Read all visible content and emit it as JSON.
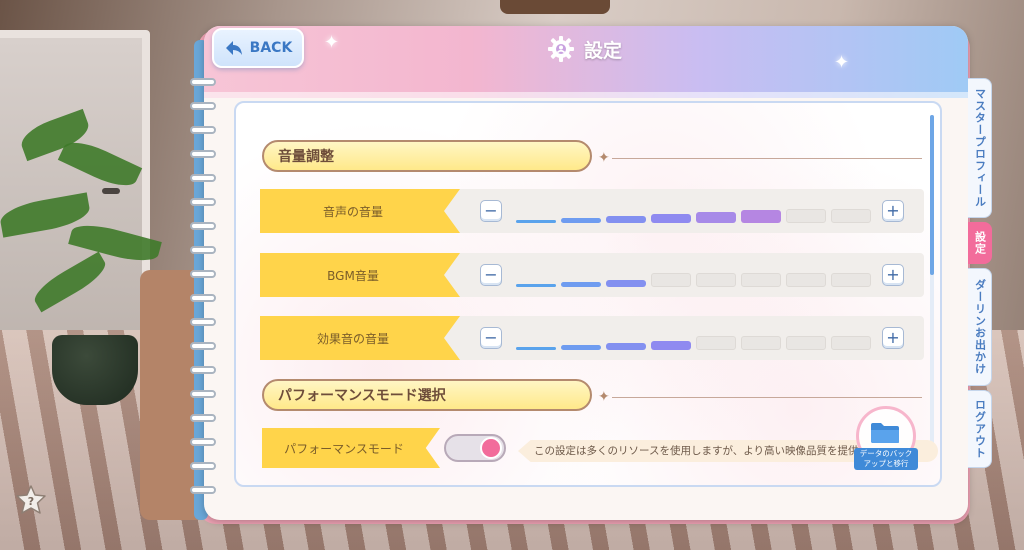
{
  "header": {
    "back_label": "BACK",
    "title": "設定"
  },
  "sections": {
    "volume_title": "音量調整",
    "performance_title": "パフォーマンスモード選択"
  },
  "volume_rows": [
    {
      "label": "音声の音量",
      "level": 6,
      "max": 8
    },
    {
      "label": "BGM音量",
      "level": 3,
      "max": 8
    },
    {
      "label": "効果音の音量",
      "level": 4,
      "max": 8
    }
  ],
  "stepper": {
    "minus": "−",
    "plus": "+"
  },
  "performance": {
    "label": "パフォーマンスモード",
    "enabled": true,
    "description": "この設定は多くのリソースを使用しますが、より高い映像品質を提供"
  },
  "side_tabs": [
    {
      "label": "マスタープロフィール",
      "active": false
    },
    {
      "label": "設定",
      "active": true
    },
    {
      "label": "ダーリンお出かけ",
      "active": false
    },
    {
      "label": "ログアウト",
      "active": false
    }
  ],
  "backup_button": {
    "caption_line1": "データのバック",
    "caption_line2": "アップと移行"
  },
  "colors": {
    "accent_pink": "#f26c9b",
    "accent_blue": "#3b78c4",
    "label_yellow": "#ffd44a"
  },
  "icons": {
    "back": "back-arrow-icon",
    "title": "gear-icon",
    "backup": "folder-icon",
    "help": "star-help-icon"
  }
}
